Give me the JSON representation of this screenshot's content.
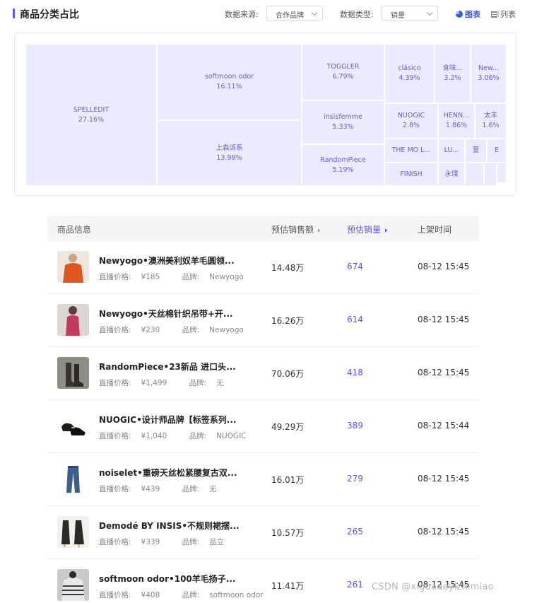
{
  "header": {
    "title": "商品分类占比",
    "source_label": "数据来源:",
    "source_value": "合作品牌",
    "type_label": "数据类型:",
    "type_value": "销量",
    "chart_view_label": "图表",
    "list_view_label": "列表",
    "accent_color": "#5b5bf0"
  },
  "treemap": [
    {
      "name": "SPELLEDIT",
      "pct": "27.16%"
    },
    {
      "name": "softmoon odor",
      "pct": "16.11%"
    },
    {
      "name": "上森派系",
      "pct": "13.98%"
    },
    {
      "name": "TOGGLER",
      "pct": "6.79%"
    },
    {
      "name": "insisfemme",
      "pct": "5.33%"
    },
    {
      "name": "RandomPiece",
      "pct": "5.19%"
    },
    {
      "name": "clásico",
      "pct": "4.39%"
    },
    {
      "name": "食味...",
      "pct": "3.2%"
    },
    {
      "name": "New...",
      "pct": "3.06%"
    },
    {
      "name": "NUOGIC",
      "pct": "2.8%"
    },
    {
      "name": "HENN...",
      "pct": "1.86%"
    },
    {
      "name": "太丰",
      "pct": "1.6%"
    },
    {
      "name": "THE MO L...",
      "pct": ""
    },
    {
      "name": "LU...",
      "pct": ""
    },
    {
      "name": "萱",
      "pct": ""
    },
    {
      "name": "E",
      "pct": ""
    },
    {
      "name": "FINISH",
      "pct": ""
    },
    {
      "name": "永璞",
      "pct": ""
    }
  ],
  "table": {
    "headers": [
      "商品信息",
      "预估销售额",
      "预估销量",
      "上架时间"
    ],
    "price_label": "直播价格:",
    "brand_label": "品牌:",
    "rows": [
      {
        "name": "Newyogo•澳洲美利奴羊毛圆领...",
        "price": "¥185",
        "brand": "Newyogo",
        "sales": "14.48万",
        "qty": "674",
        "time": "08-12 15:45"
      },
      {
        "name": "Newyogo•天丝棉针织吊带+开...",
        "price": "¥230",
        "brand": "Newyogo",
        "sales": "16.26万",
        "qty": "614",
        "time": "08-12 15:45"
      },
      {
        "name": "RandomPiece•23新品 进口头...",
        "price": "¥1,499",
        "brand": "无",
        "sales": "70.06万",
        "qty": "418",
        "time": "08-12 15:45"
      },
      {
        "name": "NUOGIC•设计师品牌【标签系列...",
        "price": "¥1,040",
        "brand": "NUOGIC",
        "sales": "49.29万",
        "qty": "389",
        "time": "08-12 15:44"
      },
      {
        "name": "noiselet•重磅天丝松紧腰复古双...",
        "price": "¥439",
        "brand": "无",
        "sales": "16.01万",
        "qty": "279",
        "time": "08-12 15:45"
      },
      {
        "name": "Demodé BY INSIS•不规则裙摆...",
        "price": "¥339",
        "brand": "品立",
        "sales": "10.57万",
        "qty": "265",
        "time": "08-12 15:45"
      },
      {
        "name": "softmoon odor•100羊毛扬子...",
        "price": "¥408",
        "brand": "softmoon odor",
        "sales": "11.41万",
        "qty": "261",
        "time": "08-12 15:45"
      }
    ]
  },
  "watermark": "CSDN @xiguadeyizhimiao"
}
